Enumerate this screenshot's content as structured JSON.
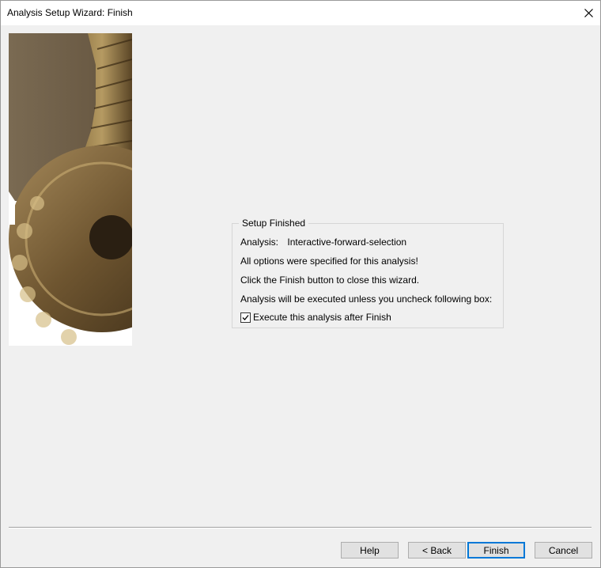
{
  "window": {
    "title": "Analysis Setup Wizard: Finish"
  },
  "groupbox": {
    "legend": "Setup Finished",
    "analysis_label": "Analysis:",
    "analysis_value": "Interactive-forward-selection",
    "line_options": "All options were specified for this analysis!",
    "line_click": "Click the Finish button to close this wizard.",
    "line_execute_note": "Analysis will be executed unless you uncheck following box:",
    "checkbox_label": "Execute this analysis after Finish",
    "checkbox_checked": true
  },
  "buttons": {
    "help": "Help",
    "back": "< Back",
    "finish": "Finish",
    "cancel": "Cancel"
  },
  "icons": {
    "close": "close-icon",
    "checkmark": "checkmark-icon"
  },
  "colors": {
    "background": "#f0f0f0",
    "default_button_border": "#0078d7"
  }
}
